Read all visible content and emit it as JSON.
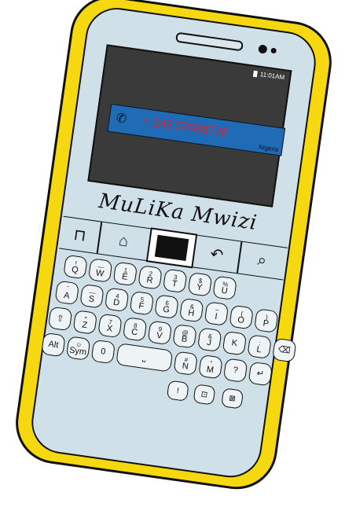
{
  "screen": {
    "status_time": "11:01AM",
    "call": {
      "number": "+ 243 57098778",
      "country": "Nigeria"
    }
  },
  "brand": "MuLiKa Mwizi",
  "nav": {
    "menu_icon": "menu-icon",
    "home_icon": "home-icon",
    "back_icon": "back-icon",
    "search_icon": "search-icon"
  },
  "keyboard": {
    "rows": [
      [
        {
          "alt": "!",
          "main": "Q"
        },
        {
          "alt": "—",
          "main": "W"
        },
        {
          "alt": "1",
          "main": "E"
        },
        {
          "alt": "2",
          "main": "R"
        },
        {
          "alt": "3",
          "main": "T"
        },
        {
          "alt": "$",
          "main": "Y"
        },
        {
          "alt": "%",
          "main": "U"
        }
      ],
      [
        {
          "alt": "‾",
          "main": "A"
        },
        {
          "alt": "—",
          "main": "S"
        },
        {
          "alt": "4",
          "main": "D"
        },
        {
          "alt": "5",
          "main": "F"
        },
        {
          "alt": "6",
          "main": "G"
        },
        {
          "alt": "&",
          "main": "H"
        },
        {
          "alt": "~",
          "main": "I"
        },
        {
          "alt": "(",
          "main": "O"
        },
        {
          "alt": ")",
          "main": "P"
        }
      ],
      [
        {
          "alt": "",
          "main": "⇧"
        },
        {
          "alt": "*",
          "main": "Z"
        },
        {
          "alt": "7",
          "main": "X"
        },
        {
          "alt": "8",
          "main": "C"
        },
        {
          "alt": "9",
          "main": "V"
        },
        {
          "alt": "@",
          "main": "B"
        },
        {
          "alt": "&",
          "main": "J"
        },
        {
          "alt": "",
          "main": "K"
        },
        {
          "alt": ":",
          "main": "L"
        },
        {
          "alt": "",
          "main": "⌫"
        }
      ],
      [
        {
          "alt": "",
          "main": "Alt"
        },
        {
          "alt": "☺",
          "main": "Sym"
        },
        {
          "alt": "",
          "main": "0"
        },
        {
          "alt": "",
          "main": "⎵"
        },
        {
          "alt": "#",
          "main": "N"
        },
        {
          "alt": "''",
          "main": "M"
        },
        {
          "alt": "",
          "main": "?"
        },
        {
          "alt": "",
          "main": "↵"
        }
      ]
    ]
  }
}
